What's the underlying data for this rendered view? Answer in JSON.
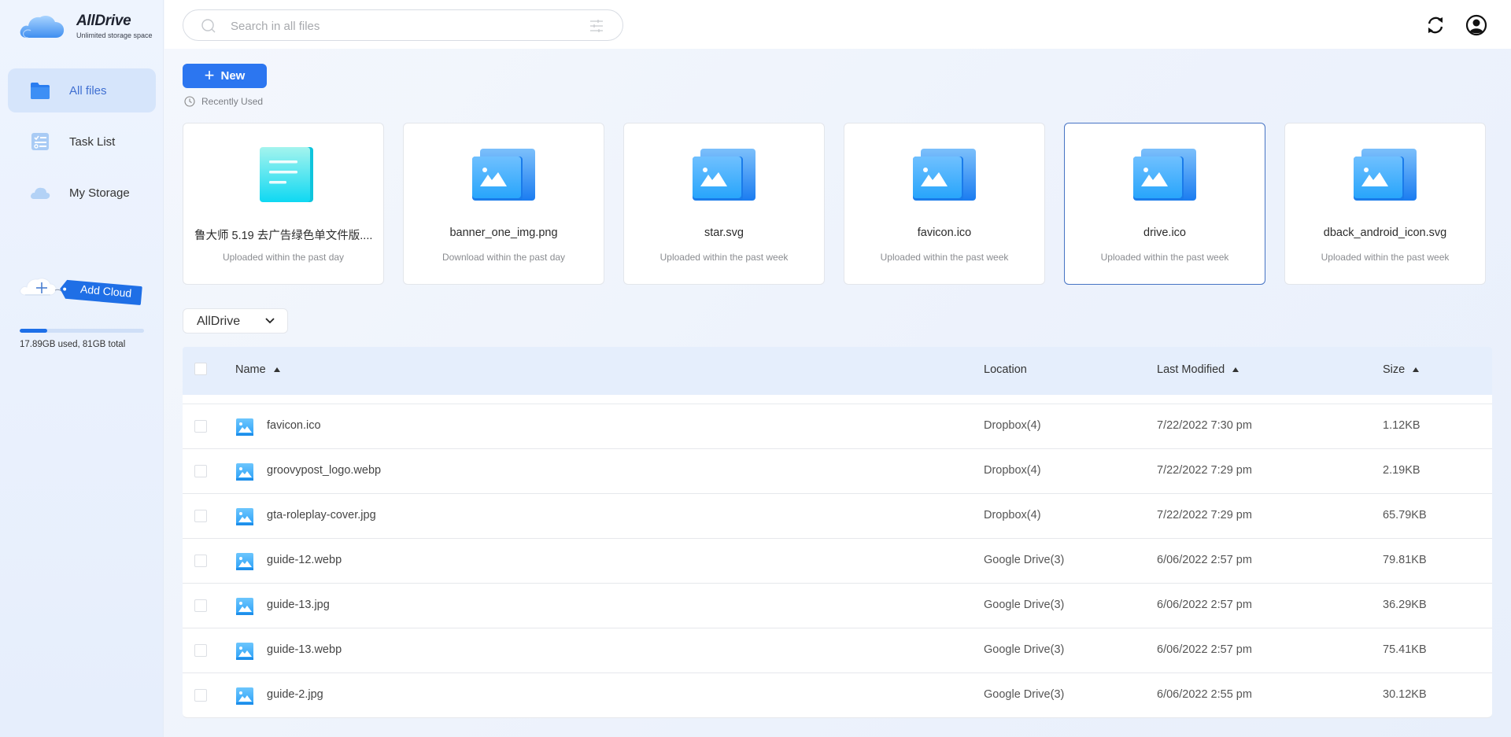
{
  "app": {
    "title": "AllDrive",
    "subtitle": "Unlimited storage space"
  },
  "sidebar": {
    "items": [
      {
        "label": "All files",
        "icon": "folder-icon",
        "active": true
      },
      {
        "label": "Task List",
        "icon": "task-list-icon",
        "active": false
      },
      {
        "label": "My Storage",
        "icon": "cloud-icon",
        "active": false
      }
    ],
    "add_cloud_label": "Add Cloud",
    "storage": {
      "used_fraction": 0.22,
      "text": "17.89GB used, 81GB total"
    }
  },
  "topbar": {
    "search_placeholder": "Search in all files",
    "search_value": "",
    "icons": [
      "search-icon",
      "filter-icon",
      "sync-icon",
      "user-account-icon"
    ]
  },
  "toolbar": {
    "new_label": "New",
    "recent_label": "Recently Used"
  },
  "recent_files": [
    {
      "name": "鲁大师 5.19 去广告绿色单文件版....",
      "status": "Uploaded within the past day",
      "type": "document",
      "selected": false
    },
    {
      "name": "banner_one_img.png",
      "status": "Download within the past day",
      "type": "image",
      "selected": false
    },
    {
      "name": "star.svg",
      "status": "Uploaded within the past week",
      "type": "image",
      "selected": false
    },
    {
      "name": "favicon.ico",
      "status": "Uploaded within the past week",
      "type": "image",
      "selected": false
    },
    {
      "name": "drive.ico",
      "status": "Uploaded within the past week",
      "type": "image",
      "selected": true
    },
    {
      "name": "dback_android_icon.svg",
      "status": "Uploaded within the past week",
      "type": "image",
      "selected": false
    }
  ],
  "drive_filter": {
    "selected": "AllDrive"
  },
  "table": {
    "columns": {
      "name": "Name",
      "location": "Location",
      "modified": "Last Modified",
      "size": "Size"
    },
    "rows": [
      {
        "name": "favicon.ico",
        "location": "Dropbox(4)",
        "modified": "7/22/2022 7:30 pm",
        "size": "1.12KB"
      },
      {
        "name": "groovypost_logo.webp",
        "location": "Dropbox(4)",
        "modified": "7/22/2022 7:29 pm",
        "size": "2.19KB"
      },
      {
        "name": "gta-roleplay-cover.jpg",
        "location": "Dropbox(4)",
        "modified": "7/22/2022 7:29 pm",
        "size": "65.79KB"
      },
      {
        "name": "guide-12.webp",
        "location": "Google Drive(3)",
        "modified": "6/06/2022 2:57 pm",
        "size": "79.81KB"
      },
      {
        "name": "guide-13.jpg",
        "location": "Google Drive(3)",
        "modified": "6/06/2022 2:57 pm",
        "size": "36.29KB"
      },
      {
        "name": "guide-13.webp",
        "location": "Google Drive(3)",
        "modified": "6/06/2022 2:57 pm",
        "size": "75.41KB"
      },
      {
        "name": "guide-2.jpg",
        "location": "Google Drive(3)",
        "modified": "6/06/2022 2:55 pm",
        "size": "30.12KB"
      }
    ]
  },
  "colors": {
    "accent": "#2c76f0",
    "active_nav_bg": "#d6e5fb",
    "table_header_bg": "#e5eefc",
    "selected_card_border": "#4673c4"
  }
}
